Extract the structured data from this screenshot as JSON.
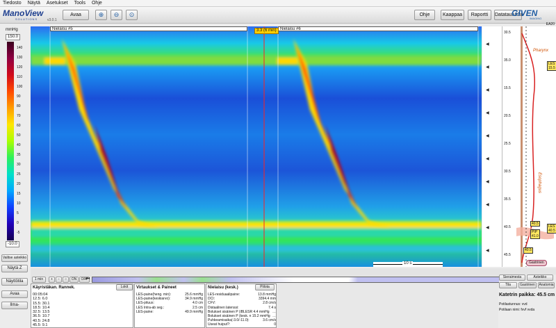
{
  "menu": [
    "Tiedosto",
    "Näytä",
    "Asetukset",
    "Tools",
    "Ohje"
  ],
  "app": {
    "logo": "ManoView",
    "logo_sub": "SOLUTIONS",
    "version": "v3.0.1",
    "brand": "GIVEN",
    "brand_sub": "IMAGING"
  },
  "toolbar": {
    "open": "Avaa",
    "help": "Ohje",
    "curves": "Kaappaa",
    "report": "Raportti",
    "datatable": "Datataulukko",
    "zoom_in_icon": "zoom-in-icon",
    "zoom_out_icon": "zoom-out-icon",
    "zoom_fit_icon": "zoom-fit-icon"
  },
  "colorbar": {
    "unit": "mmHg",
    "max": "150.0",
    "min": "-10.0",
    "ticks": [
      "140",
      "130",
      "120",
      "110",
      "100",
      "90",
      "80",
      "70",
      "60",
      "50",
      "40",
      "35",
      "30",
      "25",
      "20",
      "15",
      "10",
      "5",
      "0",
      "-5"
    ]
  },
  "left_buttons": {
    "select_scale": "Valitse asteikko",
    "show_z": "Näytä Z",
    "show": "Näyttötila",
    "open": "Avaa",
    "close": "Ilma-"
  },
  "plot": {
    "swallow1": "Nielaisu #5",
    "swallow2": "Nielaisu #6",
    "cursor_time": "3.3 (6 min)",
    "scalebar": "10 s",
    "corner_id": "EA20"
  },
  "probe": {
    "ticks": [
      "30.5",
      "35.0",
      "15.5",
      "20.5",
      "25.5",
      "30.5",
      "35.5",
      "40.5",
      "45.5"
    ],
    "labels": {
      "les1": "LES",
      "les1v": "15.5",
      "pip": "PIP",
      "pipv": "41.0",
      "les2": "LES",
      "les2v": "40.5",
      "val": "40.5",
      "gastrinen": "Gastrinen"
    },
    "pharynx": "Pharynx",
    "esophagus": "Esophagus"
  },
  "nav": {
    "min_label": "1 min",
    "on": "ON",
    "off": "OFF"
  },
  "bottom": {
    "analysis": {
      "title": "Käyristäkan. Rannek.",
      "btn": "Lokit",
      "rows": [
        "00:05:04",
        "12.5: 6.0",
        "15.5: 30.1",
        "18.5: 10.4",
        "32.5: 13.5",
        "36.5: 10.7",
        "40.5: 24.8",
        "45.5: 9.1"
      ]
    },
    "vitals": {
      "title": "Virtaukset & Paineet",
      "rows": [
        [
          "LES-paine(heng. min):",
          "25.6 mmHg"
        ],
        [
          "LES-paine(keskiarvo):",
          "34.9 mmHg"
        ],
        [
          "LES-pituus:",
          "4.0 cm"
        ],
        [
          "LES Intra-ab seg.:",
          "2.5 cm"
        ],
        [
          "LES-paine:",
          "49.9 mmHg"
        ]
      ]
    },
    "swallow": {
      "title": "Nielaisu (kesk.)",
      "btn": "Piilota",
      "rows": [
        [
          "LES-residuaalipaine:",
          "13.8 mmHg"
        ],
        [
          "DCI:",
          "3394.4 mm"
        ],
        [
          "CFV:",
          "2.8 cm/s"
        ],
        [
          "Distaalinen latenssi:",
          "7.4 s"
        ],
        [
          "Bolukset sisäinen P (iBLESR 4.4 mmHg",
          "…"
        ],
        [
          "Bolukset sisäinen P (kesk. n 15.2 mmHg",
          "…"
        ],
        [
          "Puhkeamisaika(-3.0/-11.0):",
          "3.6 cm/s"
        ],
        [
          "Useat huiput?:",
          "0"
        ]
      ]
    },
    "right": {
      "b1": "Sieraimesta",
      "b2": "Asteikko",
      "b3": "Tila",
      "b4": "Gastrinen",
      "b5": "Anatomia",
      "catheter": "Katetrin paikka: 45.5 cm",
      "patient_id": "Potilastunnus: vvd",
      "patient_name": "Potilaan nimi: fvvf vvda"
    }
  },
  "colors": {
    "accent": "#1f5da3",
    "bg": "#ececec"
  }
}
